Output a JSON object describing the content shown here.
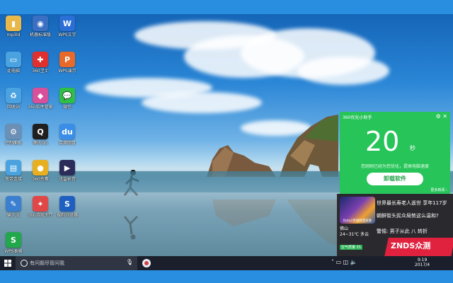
{
  "desktop": {
    "icons": [
      {
        "label": "mp3ld",
        "icon": "user-folder-icon",
        "color": "#e8b84a",
        "glyph": "▮"
      },
      {
        "label": "机器标准版",
        "icon": "device-doctor-icon",
        "color": "#3a6fc2",
        "glyph": "◉"
      },
      {
        "label": "WPS文字",
        "icon": "wps-writer-icon",
        "color": "#2b6fd6",
        "glyph": "W"
      },
      {
        "label": "此电脑",
        "icon": "computer-icon",
        "color": "#4aa3e0",
        "glyph": "▭"
      },
      {
        "label": "360卫士",
        "icon": "security-guard-icon",
        "color": "#e0302e",
        "glyph": "✚"
      },
      {
        "label": "WPS演示",
        "icon": "wps-presentation-icon",
        "color": "#e86a2a",
        "glyph": "P"
      },
      {
        "label": "回收站",
        "icon": "recycle-bin-icon",
        "color": "#4aa3e0",
        "glyph": "♻"
      },
      {
        "label": "360软件管家",
        "icon": "software-manager-icon",
        "color": "#d84f9a",
        "glyph": "◆"
      },
      {
        "label": "微信",
        "icon": "wechat-icon",
        "color": "#2fbf47",
        "glyph": "💬"
      },
      {
        "label": "控制面板",
        "icon": "control-panel-icon",
        "color": "#6b8fb5",
        "glyph": "⚙"
      },
      {
        "label": "腾讯QQ",
        "icon": "qq-icon",
        "color": "#1f1f1f",
        "glyph": "Q"
      },
      {
        "label": "百度网盘",
        "icon": "baidu-netdisk-icon",
        "color": "#3a8ee8",
        "glyph": "du"
      },
      {
        "label": "宽带连接",
        "icon": "broadband-icon",
        "color": "#4aa3e0",
        "glyph": "▤"
      },
      {
        "label": "360杀毒",
        "icon": "antivirus-icon",
        "color": "#e8b020",
        "glyph": "●"
      },
      {
        "label": "迅雷影音",
        "icon": "video-player-icon",
        "color": "#2c2c5a",
        "glyph": "▶"
      },
      {
        "label": "输入法",
        "icon": "input-method-icon",
        "color": "#3a7fd0",
        "glyph": "✎"
      },
      {
        "label": "360游戏大厅",
        "icon": "game-center-icon",
        "color": "#e04848",
        "glyph": "✦"
      },
      {
        "label": "搜狗浏览器",
        "icon": "sogou-browser-icon",
        "color": "#1e5fbf",
        "glyph": "S"
      },
      {
        "label": "WPS表格",
        "icon": "wps-spreadsheet-icon",
        "color": "#21a84a",
        "glyph": "S"
      }
    ]
  },
  "popup": {
    "title": "360优化小助手",
    "seconds": "20",
    "unit": "秒",
    "message": "您刚刚已经为您优化，提高电脑速度",
    "button": "卸载软件",
    "more": "更多新闻 ›",
    "accent": "#27c45a"
  },
  "news": {
    "thumb_caption": "Dota2英雄联盟皮肤",
    "headline_1": "世界最长寿老人逝世 享年117岁",
    "headline_2": "朝鲜街头民众局势这么温和?",
    "headline_3": "警惕: 男子从此 八 转折",
    "weather_city": "佛山",
    "weather_temp": "24~31℃ 多云",
    "aqi": "空气质量 55"
  },
  "watermark": {
    "text": "ZNDS众测"
  },
  "taskbar": {
    "search_placeholder": "有问题尽管问我",
    "clock_time": "9:19",
    "clock_date": "2017/4"
  }
}
